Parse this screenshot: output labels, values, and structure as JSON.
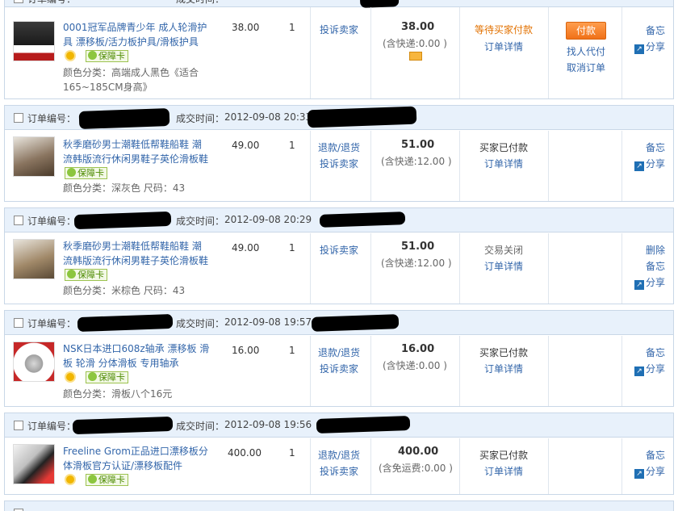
{
  "labels": {
    "order_no": "订单编号：",
    "deal_time": "成交时间：",
    "complain": "投诉卖家",
    "refund": "退款/退货",
    "detail": "订单详情",
    "memo": "备忘",
    "share": "分享",
    "delete": "删除",
    "baozhang": "保障卡",
    "pay": "付款",
    "find_payer": "找人代付",
    "cancel_order": "取消订单"
  },
  "colors": {
    "accent_blue": "#3366aa",
    "header_bg": "#e8f1fb",
    "pay_orange": "#f07118",
    "border": "#c9d7e7"
  },
  "orders": [
    {
      "time": "",
      "product": "0001冠军品牌青少年 成人轮滑护具 漂移板/活力板护具/滑板护具",
      "attr": "颜色分类：高端成人黑色《适合165~185CM身高》",
      "price": "38.00",
      "qty": "1",
      "total": "38.00",
      "shipping_note": "(含快递:0.00 )",
      "status": "等待买家付款"
    },
    {
      "time": "2012-09-08 20:33",
      "product": "秋季磨砂男士潮鞋低帮鞋船鞋 潮流韩版流行休闲男鞋子英伦滑板鞋",
      "attr": "颜色分类：深灰色 尺码：43",
      "price": "49.00",
      "qty": "1",
      "total": "51.00",
      "shipping_note": "(含快递:12.00 )",
      "status": "买家已付款"
    },
    {
      "time": "2012-09-08 20:29",
      "product": "秋季磨砂男士潮鞋低帮鞋船鞋 潮流韩版流行休闲男鞋子英伦滑板鞋",
      "attr": "颜色分类：米棕色 尺码：43",
      "price": "49.00",
      "qty": "1",
      "total": "51.00",
      "shipping_note": "(含快递:12.00 )",
      "status": "交易关闭"
    },
    {
      "time": "2012-09-08 19:57",
      "product": "NSK日本进口608z轴承 漂移板 滑板 轮滑 分体滑板 专用轴承",
      "attr": "颜色分类：滑板八个16元",
      "price": "16.00",
      "qty": "1",
      "total": "16.00",
      "shipping_note": "(含快递:0.00 )",
      "status": "买家已付款"
    },
    {
      "time": "2012-09-08 19:56",
      "product": "Freeline Grom正品进口漂移板分体滑板官方认证/漂移板配件",
      "attr": "",
      "price": "400.00",
      "qty": "1",
      "total": "400.00",
      "shipping_note": "(含免运费:0.00 )",
      "status": "买家已付款"
    }
  ]
}
